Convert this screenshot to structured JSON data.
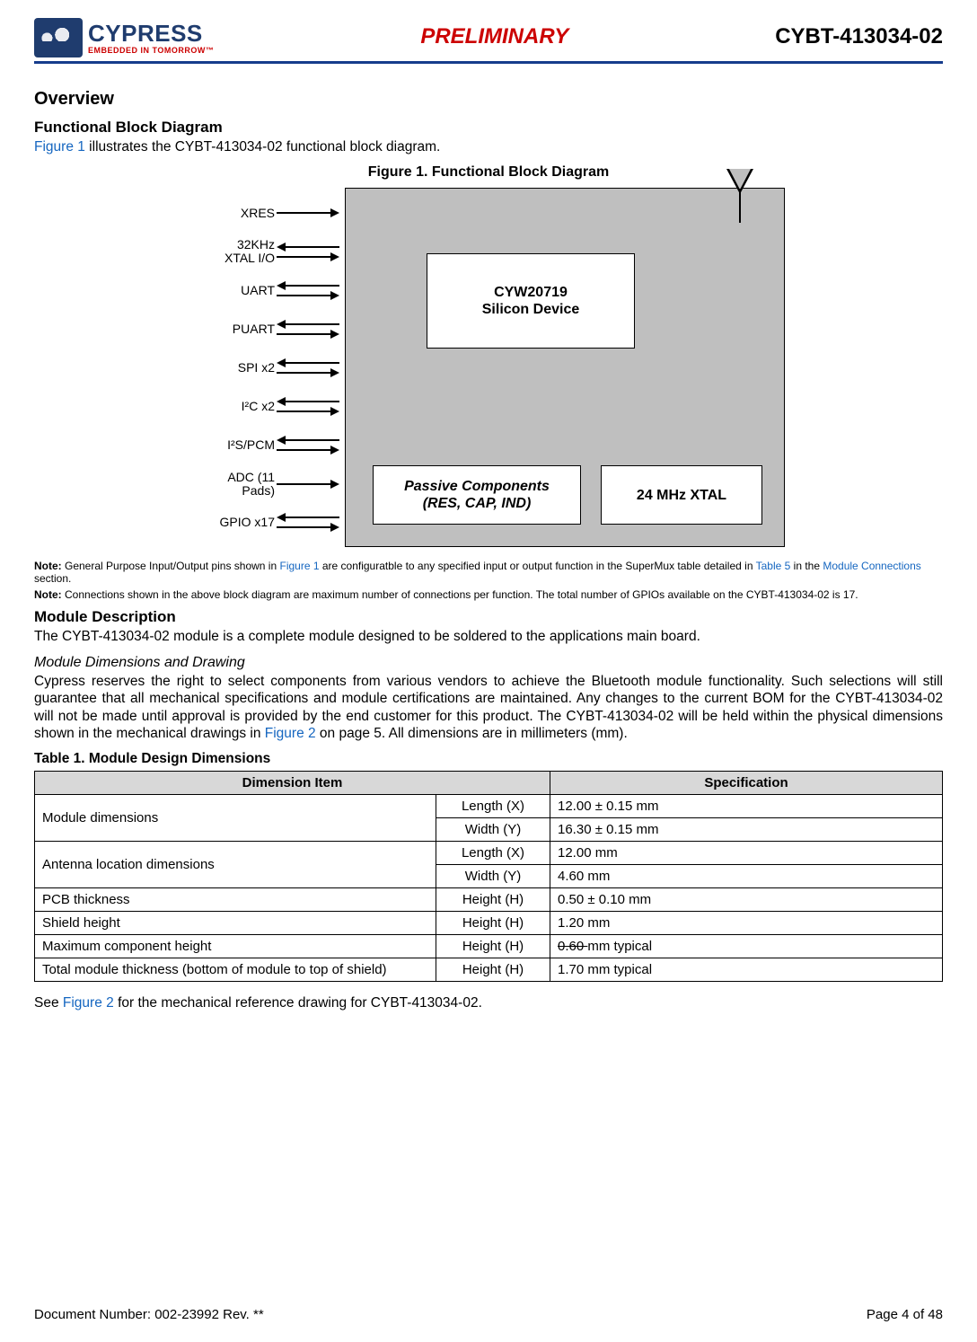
{
  "header": {
    "logo_main": "CYPRESS",
    "logo_sub": "EMBEDDED IN TOMORROW™",
    "preliminary": "PRELIMINARY",
    "part": "CYBT-413034-02"
  },
  "overview_h": "Overview",
  "fbd_h": "Functional Block Diagram",
  "fbd_intro_pre": "Figure 1",
  "fbd_intro_post": " illustrates the CYBT-413034-02 functional block diagram.",
  "fig1_caption": "Figure 1.  Functional Block Diagram",
  "diagram": {
    "signals": [
      {
        "label": "XRES",
        "dir": "r"
      },
      {
        "label": "32KHz\nXTAL I/O",
        "dir": "bi"
      },
      {
        "label": "UART",
        "dir": "bi"
      },
      {
        "label": "PUART",
        "dir": "bi"
      },
      {
        "label": "SPI x2",
        "dir": "bi"
      },
      {
        "label": "I²C x2",
        "dir": "bi"
      },
      {
        "label": "I²S/PCM",
        "dir": "bi"
      },
      {
        "label": "ADC (11 Pads)",
        "dir": "r"
      },
      {
        "label": "GPIO x17",
        "dir": "bi"
      }
    ],
    "silicon": "CYW20719\nSilicon Device",
    "passive": "Passive Components\n(RES, CAP, IND)",
    "xtal": "24 MHz XTAL"
  },
  "note1_pre": "Note: ",
  "note1_a": "General Purpose Input/Output pins shown in ",
  "note1_fig": "Figure 1",
  "note1_b": " are configuratble to any specified input or output function in the SuperMux table detailed in ",
  "note1_tbl": "Table 5",
  "note1_c": " in the ",
  "note1_link": "Module Connections",
  "note1_d": " section.",
  "note2_pre": "Note: ",
  "note2_body": "Connections shown in the above block diagram are maximum number of connections per function. The total number of GPIOs available on the CYBT-413034-02 is 17.",
  "moddesc_h": "Module Description",
  "moddesc_body": "The CYBT-413034-02 module is a complete module designed to be soldered to the applications main board.",
  "dims_h": "Module Dimensions and Drawing",
  "dims_body_a": "Cypress reserves the right to select components from various vendors to achieve the Bluetooth module functionality. Such selections will still guarantee that all mechanical specifications and module certifications are maintained. Any changes to the current BOM for the CYBT-413034-02 will not be made until approval is provided by the end customer for this product. The CYBT-413034-02 will be held within the physical dimensions shown in the mechanical drawings in ",
  "dims_body_fig": "Figure 2",
  "dims_body_b": " on page 5. All dimensions are in millimeters (mm).",
  "table1_caption": "Table 1.  Module Design Dimensions",
  "table1": {
    "headers": [
      "Dimension Item",
      "Specification"
    ],
    "rows": [
      {
        "item": "Module dimensions",
        "axis": "Length (X)",
        "spec": "12.00 ± 0.15 mm",
        "rowspan": 2
      },
      {
        "item": "",
        "axis": "Width (Y)",
        "spec": "16.30 ± 0.15 mm"
      },
      {
        "item": "Antenna location dimensions",
        "axis": "Length (X)",
        "spec": "12.00 mm",
        "rowspan": 2
      },
      {
        "item": "",
        "axis": "Width (Y)",
        "spec": "4.60 mm"
      },
      {
        "item": "PCB thickness",
        "axis": "Height (H)",
        "spec": "0.50 ± 0.10 mm"
      },
      {
        "item": "Shield height",
        "axis": "Height (H)",
        "spec": "1.20 mm"
      },
      {
        "item": "Maximum component height",
        "axis": "Height (H)",
        "spec_strike": "0.60 ",
        "spec_after": "mm typical"
      },
      {
        "item": "Total module thickness (bottom of module to top of shield)",
        "axis": "Height (H)",
        "spec": "1.70 mm typical"
      }
    ]
  },
  "see_fig2_a": "See ",
  "see_fig2_link": "Figure 2",
  "see_fig2_b": " for the mechanical reference drawing for CYBT-413034-02.",
  "footer": {
    "doc": "Document Number: 002-23992 Rev. **",
    "page": "Page 4 of 48"
  }
}
